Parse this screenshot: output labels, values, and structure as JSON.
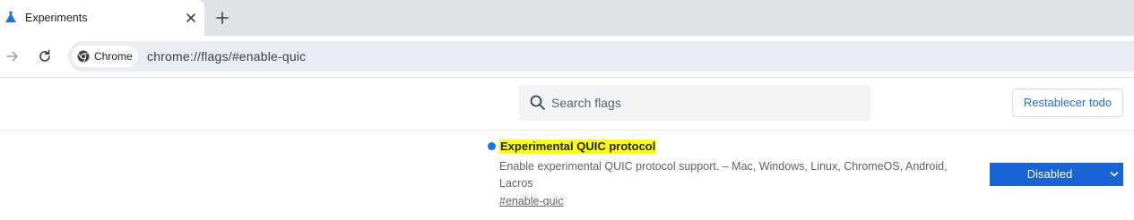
{
  "tab": {
    "title": "Experiments"
  },
  "omnibox": {
    "chip_label": "Chrome",
    "url": "chrome://flags/#enable-quic"
  },
  "search": {
    "placeholder": "Search flags",
    "value": ""
  },
  "reset_button": {
    "label": "Restablecer todo"
  },
  "flag": {
    "title": "Experimental QUIC protocol",
    "description": "Enable experimental QUIC protocol support. – Mac, Windows, Linux, ChromeOS, Android, Lacros",
    "anchor": "#enable-quic",
    "selected_option": "Disabled"
  },
  "colors": {
    "accent": "#1a73e8",
    "highlight": "#ffff00",
    "select_bg": "#1a63d6"
  },
  "icons": [
    "flask-icon",
    "close-icon",
    "plus-icon",
    "arrow-forward-icon",
    "reload-icon",
    "chrome-logo-icon",
    "search-icon",
    "chevron-down-icon"
  ]
}
